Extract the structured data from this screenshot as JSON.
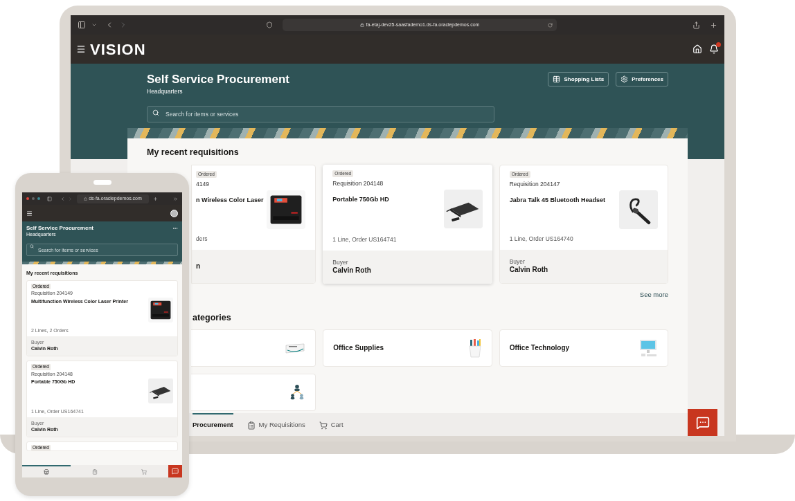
{
  "laptop": {
    "browser": {
      "url": "fa-etaj-dev25-saasfademo1.ds-fa.oraclepdemos.com"
    },
    "app_header": {
      "logo": "VISION"
    },
    "hero": {
      "title": "Self Service Procurement",
      "subtitle": "Headquarters",
      "search": {
        "placeholder": "Search for items or services"
      },
      "buttons": [
        {
          "label": "Shopping Lists",
          "kind": "list"
        },
        {
          "label": "Preferences",
          "kind": "settings"
        }
      ]
    },
    "recent": {
      "heading": "My recent requisitions",
      "cards": [
        {
          "status": "Ordered",
          "requisition": "4149",
          "title": "n Wireless Color Laser",
          "summary": "ders",
          "buyer": "n",
          "kind": "printer"
        },
        {
          "status": "Ordered",
          "requisition": "Requisition 204148",
          "title": "Portable 750Gb HD",
          "summary": "1 Line, Order US164741",
          "buyer_label": "Buyer",
          "buyer": "Calvin Roth",
          "kind": "drive"
        },
        {
          "status": "Ordered",
          "requisition": "Requisition 204147",
          "title": "Jabra Talk 45 Bluetooth Headset",
          "summary": "1 Line, Order US164740",
          "buyer_label": "Buyer",
          "buyer": "Calvin Roth",
          "kind": "headset"
        }
      ],
      "see_more": "See more"
    },
    "categories": {
      "heading": "ategories",
      "items": [
        {
          "kind": "packaging"
        },
        {
          "label": "Office Supplies",
          "kind": "supplies"
        },
        {
          "label": "Office Technology",
          "kind": "computer"
        },
        {
          "kind": "org-chart"
        }
      ]
    },
    "tabs": [
      {
        "label": "Procurement",
        "selected": true
      },
      {
        "label": "My Requisitions",
        "kind": "clipboard",
        "selected": false
      },
      {
        "label": "Cart",
        "kind": "cart",
        "selected": false
      }
    ]
  },
  "phone": {
    "browser": {
      "url": "ds-fa.oraclepdemos.com"
    },
    "hero": {
      "title": "Self Service Procurement",
      "subtitle": "Headquarters",
      "search": {
        "placeholder": "Search for items or services"
      }
    },
    "recent": {
      "heading": "My recent requisitions",
      "cards": [
        {
          "status": "Ordered",
          "requisition": "Requisition 204149",
          "title": "Multifunction Wireless Color Laser Printer",
          "summary": "2 Lines, 2 Orders",
          "buyer_label": "Buyer",
          "buyer": "Calvin Roth",
          "kind": "printer"
        },
        {
          "status": "Ordered",
          "requisition": "Requisition 204148",
          "title": "Portable 750Gb HD",
          "summary": "1 Line, Order US164741",
          "buyer_label": "Buyer",
          "buyer": "Calvin Roth",
          "kind": "drive"
        },
        {
          "status": "Ordered"
        }
      ]
    },
    "tabs": [
      {
        "kind": "store",
        "selected": true
      },
      {
        "kind": "clipboard",
        "selected": false
      },
      {
        "kind": "cart",
        "selected": false
      }
    ]
  }
}
